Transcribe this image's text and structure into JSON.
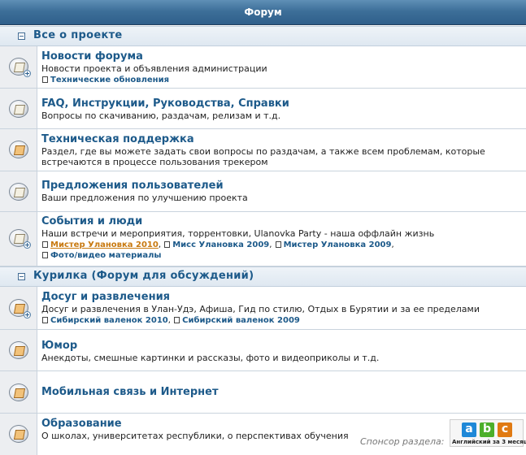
{
  "header": {
    "title": "Форум"
  },
  "categories": [
    {
      "title": "Все о проекте",
      "forums": [
        {
          "title": "Новости форума",
          "description": "Новости проекта и объявления администрации",
          "subforums": [
            "Технические обновления"
          ]
        },
        {
          "title": "FAQ, Инструкции, Руководства, Справки",
          "description": "Вопросы по скачиванию, раздачам, релизам и т.д.",
          "subforums": []
        },
        {
          "title": "Техническая поддержка",
          "description_lines": [
            "Раздел, где вы можете задать свои вопросы по раздачам, а также всем проблемам, которые",
            "встречаются в процессе пользования трекером"
          ],
          "subforums": []
        },
        {
          "title": "Предложения пользователей",
          "description": "Ваши предложения по улучшению проекта",
          "subforums": []
        },
        {
          "title": "События и люди",
          "description": "Наши встречи и мероприятия, торрентовки, Ulanovka Party - наша оффлайн жизнь",
          "subforums": [
            "Мистер Улановка 2010",
            "Мисс Улановка 2009",
            "Мистер Улановка 2009",
            "Фото/видео материалы"
          ]
        }
      ]
    },
    {
      "title": "Курилка (Форум для обсуждений)",
      "forums": [
        {
          "title": "Досуг и развлечения",
          "description": "Досуг и развлечения в Улан-Удэ, Афиша, Гид по стилю, Отдых в Бурятии и за ее пределами",
          "subforums": [
            "Сибирский валенок 2010",
            "Сибирский валенок 2009"
          ]
        },
        {
          "title": "Юмор",
          "description": "Анекдоты, смешные картинки и рассказы, фото и видеоприколы и т.д.",
          "subforums": []
        },
        {
          "title": "Мобильная связь и Интернет",
          "description": "",
          "subforums": []
        },
        {
          "title": "Образование",
          "description": "О школах, университетах республики, о перспективах обучения",
          "subforums": []
        }
      ]
    }
  ],
  "sponsor": {
    "label": "Спонсор раздела:",
    "banner_letters": [
      "a",
      "b",
      "c"
    ],
    "banner_caption": "Английский за 3 месяца",
    "banner_colors": [
      "#1e88d8",
      "#4caf2a",
      "#e07a12"
    ]
  },
  "colors": {
    "header_bg": "#3d6f99",
    "link": "#1d5a8a",
    "active_link": "#c8790f"
  }
}
